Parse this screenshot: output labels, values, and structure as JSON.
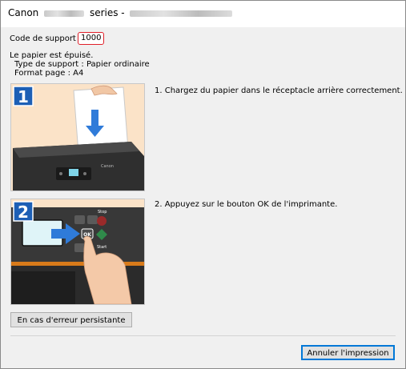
{
  "window": {
    "title_prefix": "Canon",
    "title_suffix": "series -"
  },
  "support": {
    "label": "Code de support",
    "code": "1000"
  },
  "message": {
    "line1": "Le papier est épuisé.",
    "line2": "Type de support : Papier ordinaire",
    "line3": "Format page : A4"
  },
  "steps": [
    {
      "number": "1",
      "instruction": "1.  Chargez du papier dans le réceptacle arrière correctement."
    },
    {
      "number": "2",
      "instruction": "2.  Appuyez sur le bouton OK de l'imprimante."
    }
  ],
  "printer_labels": {
    "brand": "Canon",
    "stop": "Stop",
    "start": "Start",
    "ok": "OK"
  },
  "buttons": {
    "persistent_error": "En cas d'erreur persistante",
    "cancel_print": "Annuler l'impression"
  },
  "colors": {
    "code_highlight": "#e0202a",
    "step_badge": "#1d5fb5",
    "arrow": "#2f7bd9",
    "illustration_bg": "#fbe3c8"
  },
  "icons": {
    "step1_arrow": "arrow-down-icon",
    "step2_arrow": "arrow-right-icon"
  }
}
